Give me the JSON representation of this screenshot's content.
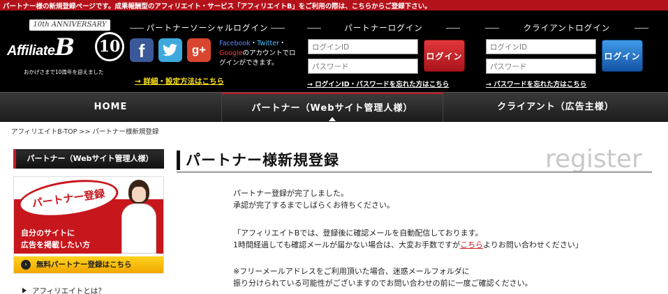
{
  "topbar": {
    "text": "パートナー様の新規登録ページです。成果報酬型のアフィリエイト・サービス「アフィリエイトB」をご利用の際は、こちらからご登録下さい。"
  },
  "logo": {
    "anniversary": "10th ANNIVERSARY",
    "brand_prefix": "Affiliate",
    "brand_letter": "B",
    "ten": "10",
    "tagline": "おかげさまで10周年を迎えました"
  },
  "social_login": {
    "title": "パートナーソーシャルログイン",
    "icons": [
      "facebook-icon",
      "twitter-icon",
      "google-plus-icon"
    ],
    "text_facebook": "Facebook",
    "text_sep1": "・",
    "text_twitter": "Twitter",
    "text_sep2": "・",
    "text_google": "Google",
    "text_rest": "のアカウントでログインができます。",
    "setting_link": "→ 詳細・設定方法はこちら"
  },
  "partner_login": {
    "title": "パートナーログイン",
    "id_placeholder": "ログインID",
    "pw_placeholder": "パスワード",
    "button": "ログイン",
    "forgot": "→ ログインID・パスワードを忘れた方はこちら"
  },
  "client_login": {
    "title": "クライアントログイン",
    "id_placeholder": "ログインID",
    "pw_placeholder": "パスワード",
    "button": "ログイン",
    "forgot": "→ パスワードを忘れた方はこちら"
  },
  "nav": {
    "home": "HOME",
    "partner": "パートナー（Webサイト管理人様）",
    "client": "クライアント（広告主様）"
  },
  "breadcrumb": "アフィリエイトB-TOP >> パートナー様新規登録",
  "sidebar": {
    "heading": "パートナー（Webサイト管理人様）",
    "banner_bubble": "パートナー登録",
    "banner_line1": "自分のサイトに",
    "banner_line2": "広告を掲載したい方",
    "banner_cta": "無料パートナー登録はこちら",
    "link1": "アフィリエイトとは？"
  },
  "main": {
    "title": "パートナー様新規登録",
    "title_en": "register",
    "p1_line1": "パートナー登録が完了しました。",
    "p1_line2": "承認が完了するまでしばらくお待ちください。",
    "p2_line1": "「アフィリエイトBでは、登録後に確認メールを自動配信しております。",
    "p2_line2_pre": "1時間経過しても確認メールが届かない場合は、大変お手数ですが",
    "p2_line2_link": "こちら",
    "p2_line2_post": "よりお問い合わせください」",
    "p3_line1": "※フリーメールアドレスをご利用頂いた場合、迷惑メールフォルダに",
    "p3_line2": "振り分けられている可能性がございますのでお問い合わせの前に一度ご確認ください。"
  },
  "colors": {
    "brand_red": "#b3121a",
    "header_bg": "#000000",
    "link_yellow": "#ffe31a",
    "client_blue": "#1554a4"
  }
}
